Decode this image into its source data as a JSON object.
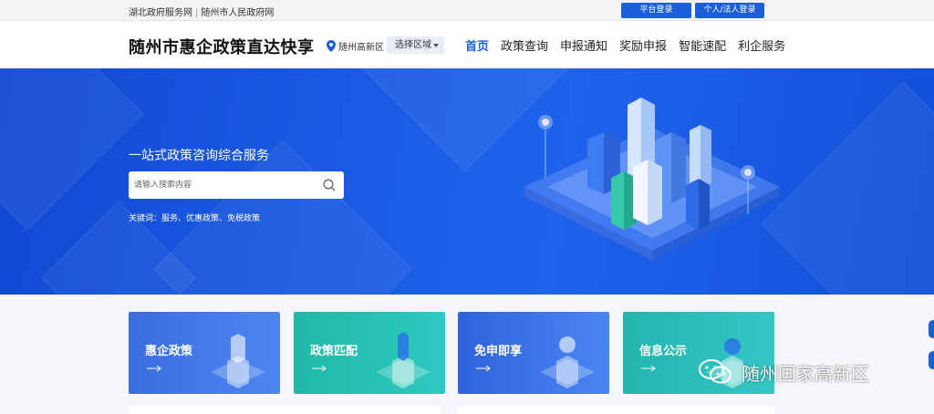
{
  "topbar": {
    "links": [
      "湖北政府服务网",
      "随州市人民政府网"
    ],
    "separator": "|",
    "platform_login": "平台登录",
    "personal_login": "个人/法人登录"
  },
  "header": {
    "site_title": "随州市惠企政策直达快享",
    "location": "随州高新区",
    "region_select": "选择区域",
    "nav": [
      "首页",
      "政策查询",
      "申报通知",
      "奖励申报",
      "智能速配",
      "利企服务"
    ],
    "nav_active_index": 0
  },
  "hero": {
    "title": "一站式政策咨询综合服务",
    "search_placeholder": "请输入搜索内容",
    "keywords_label": "关键词：",
    "keywords": "服务、优惠政策、免税政策"
  },
  "cards": [
    {
      "label": "惠企政策",
      "arrow": "→"
    },
    {
      "label": "政策匹配",
      "arrow": "→"
    },
    {
      "label": "免申即享",
      "arrow": "→"
    },
    {
      "label": "信息公示",
      "arrow": "→"
    }
  ],
  "watermark": {
    "text": "随州国家高新区",
    "icon": "wechat-icon"
  },
  "colors": {
    "primary": "#1a5fd8",
    "hero": "#1d5ee6",
    "teal": "#2ec9c1"
  }
}
